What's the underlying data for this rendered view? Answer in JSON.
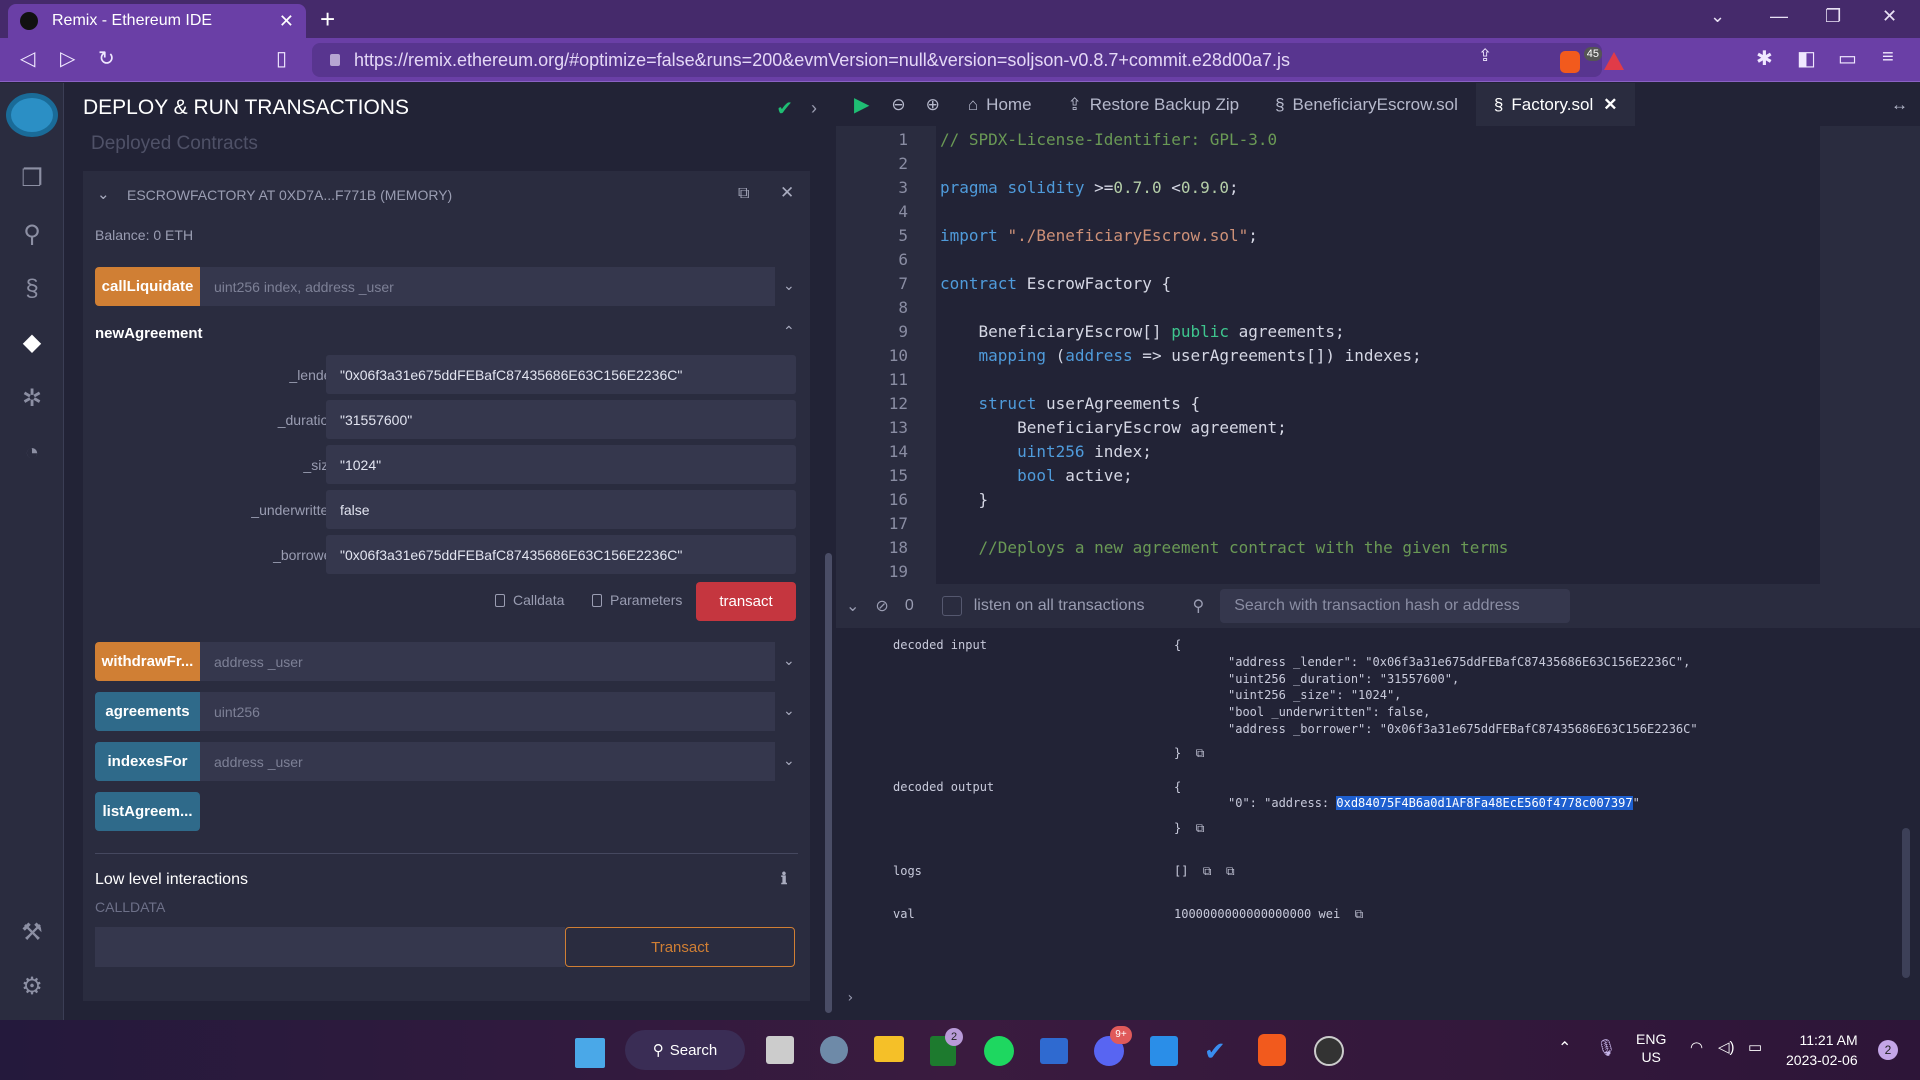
{
  "browser": {
    "tab_title": "Remix - Ethereum IDE",
    "url": "https://remix.ethereum.org/#optimize=false&runs=200&evmVersion=null&version=soljson-v0.8.7+commit.e28d00a7.js",
    "shields_count": "45"
  },
  "icon_panel": [
    "file-explorer-icon",
    "search-icon",
    "solidity-compiler-icon",
    "deploy-run-icon",
    "debugger-icon",
    "analysis-icon",
    "plugin-manager-icon",
    "settings-icon"
  ],
  "side_panel": {
    "title": "DEPLOY & RUN TRANSACTIONS",
    "deployed_title": "Deployed Contracts",
    "contract_name": "ESCROWFACTORY AT 0XD7A...F771B (MEMORY)",
    "balance": "Balance: 0 ETH",
    "functions": [
      {
        "name": "callLiquidate",
        "placeholder": "uint256 index, address _user",
        "color": "#d07f34"
      },
      {
        "name": "withdrawFr...",
        "placeholder": "address _user",
        "color": "#d07f34"
      },
      {
        "name": "agreements",
        "placeholder": "uint256",
        "color": "#2f6a8a"
      },
      {
        "name": "indexesFor",
        "placeholder": "address _user",
        "color": "#2f6a8a"
      },
      {
        "name": "listAgreem...",
        "placeholder": "",
        "color": "#2f6a8a"
      }
    ],
    "expanded_function": {
      "name": "newAgreement",
      "params": [
        {
          "label": "_lender:",
          "value": "\"0x06f3a31e675ddFEBafC87435686E63C156E2236C\""
        },
        {
          "label": "_duration:",
          "value": "\"31557600\""
        },
        {
          "label": "_size:",
          "value": "\"1024\""
        },
        {
          "label": "_underwritten:",
          "value": "false"
        },
        {
          "label": "_borrower:",
          "value": "\"0x06f3a31e675ddFEBafC87435686E63C156E2236C\""
        }
      ],
      "calldata_label": "Calldata",
      "parameters_label": "Parameters",
      "transact_label": "transact"
    },
    "low_level": {
      "title": "Low level interactions",
      "calldata_label": "CALLDATA",
      "calldata_value": "",
      "transact_label": "Transact"
    }
  },
  "editor": {
    "tabs": [
      "Home",
      "Restore Backup Zip",
      "BeneficiaryEscrow.sol",
      "Factory.sol"
    ],
    "active_tab": "Factory.sol",
    "lines": [
      "// SPDX-License-Identifier: GPL-3.0",
      "",
      "pragma solidity >=0.7.0 <0.9.0;",
      "",
      "import \"./BeneficiaryEscrow.sol\";",
      "",
      "contract EscrowFactory {",
      "",
      "    BeneficiaryEscrow[] public agreements;",
      "    mapping (address => userAgreements[]) indexes;",
      "",
      "    struct userAgreements {",
      "        BeneficiaryEscrow agreement;",
      "        uint256 index;",
      "        bool active;",
      "    }",
      "",
      "    //Deploys a new agreement contract with the given terms",
      ""
    ]
  },
  "terminal": {
    "pending_count": "0",
    "listen_label": "listen on all transactions",
    "search_placeholder": "Search with transaction hash or address",
    "decoded_input_label": "decoded input",
    "decoded_input": [
      "\"address _lender\": \"0x06f3a31e675ddFEBafC87435686E63C156E2236C\",",
      "\"uint256 _duration\": \"31557600\",",
      "\"uint256 _size\": \"1024\",",
      "\"bool _underwritten\": false,",
      "\"address _borrower\": \"0x06f3a31e675ddFEBafC87435686E63C156E2236C\""
    ],
    "decoded_output_label": "decoded output",
    "decoded_output_prefix": "\"0\": \"address: ",
    "decoded_output_address": "0xd84075F4B6a0d1AF8Fa48EcE560f4778c007397",
    "logs_label": "logs",
    "logs_value": "[]",
    "val_label": "val",
    "val_value": "1000000000000000000 wei"
  },
  "taskbar": {
    "search_label": "Search",
    "lang": "ENG",
    "region": "US",
    "time": "11:21 AM",
    "date": "2023-02-06",
    "notifications": "2",
    "xbox_badge": "2",
    "discord_badge": "9+"
  }
}
